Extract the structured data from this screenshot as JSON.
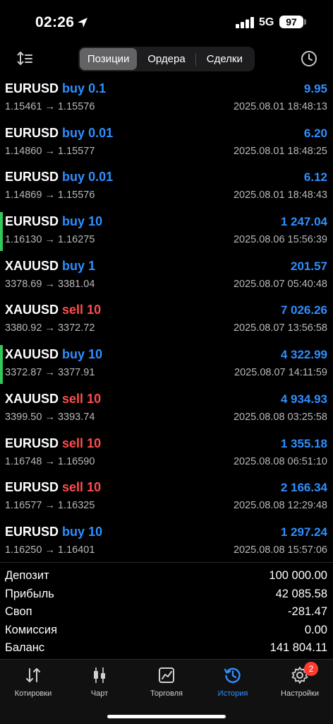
{
  "status": {
    "time": "02:26",
    "network": "5G",
    "battery": "97"
  },
  "tabs": [
    {
      "label": "Позиции",
      "active": true
    },
    {
      "label": "Ордера",
      "active": false
    },
    {
      "label": "Сделки",
      "active": false
    }
  ],
  "rows": [
    {
      "symbol": "EURUSD",
      "side": "buy",
      "volume": "0.1",
      "prices": "1.15461 → 1.15576",
      "profit": "9.95",
      "date": "2025.08.01 18:48:13",
      "marked": false
    },
    {
      "symbol": "EURUSD",
      "side": "buy",
      "volume": "0.01",
      "prices": "1.14860 → 1.15577",
      "profit": "6.20",
      "date": "2025.08.01 18:48:25",
      "marked": false
    },
    {
      "symbol": "EURUSD",
      "side": "buy",
      "volume": "0.01",
      "prices": "1.14869 → 1.15576",
      "profit": "6.12",
      "date": "2025.08.01 18:48:43",
      "marked": false
    },
    {
      "symbol": "EURUSD",
      "side": "buy",
      "volume": "10",
      "prices": "1.16130 → 1.16275",
      "profit": "1 247.04",
      "date": "2025.08.06 15:56:39",
      "marked": true
    },
    {
      "symbol": "XAUUSD",
      "side": "buy",
      "volume": "1",
      "prices": "3378.69 → 3381.04",
      "profit": "201.57",
      "date": "2025.08.07 05:40:48",
      "marked": false
    },
    {
      "symbol": "XAUUSD",
      "side": "sell",
      "volume": "10",
      "prices": "3380.92 → 3372.72",
      "profit": "7 026.26",
      "date": "2025.08.07 13:56:58",
      "marked": false
    },
    {
      "symbol": "XAUUSD",
      "side": "buy",
      "volume": "10",
      "prices": "3372.87 → 3377.91",
      "profit": "4 322.99",
      "date": "2025.08.07 14:11:59",
      "marked": true
    },
    {
      "symbol": "XAUUSD",
      "side": "sell",
      "volume": "10",
      "prices": "3399.50 → 3393.74",
      "profit": "4 934.93",
      "date": "2025.08.08 03:25:58",
      "marked": false
    },
    {
      "symbol": "EURUSD",
      "side": "sell",
      "volume": "10",
      "prices": "1.16748 → 1.16590",
      "profit": "1 355.18",
      "date": "2025.08.08 06:51:10",
      "marked": false
    },
    {
      "symbol": "EURUSD",
      "side": "sell",
      "volume": "10",
      "prices": "1.16577 → 1.16325",
      "profit": "2 166.34",
      "date": "2025.08.08 12:29:48",
      "marked": false
    },
    {
      "symbol": "EURUSD",
      "side": "buy",
      "volume": "10",
      "prices": "1.16250 → 1.16401",
      "profit": "1 297.24",
      "date": "2025.08.08 15:57:06",
      "marked": false
    }
  ],
  "summary": [
    {
      "label": "Депозит",
      "value": "100 000.00"
    },
    {
      "label": "Прибыль",
      "value": "42 085.58"
    },
    {
      "label": "Своп",
      "value": "-281.47"
    },
    {
      "label": "Комиссия",
      "value": "0.00"
    },
    {
      "label": "Баланс",
      "value": "141 804.11"
    }
  ],
  "tabbar": [
    {
      "label": "Котировки",
      "icon": "quotes-icon",
      "active": false
    },
    {
      "label": "Чарт",
      "icon": "chart-icon",
      "active": false
    },
    {
      "label": "Торговля",
      "icon": "trade-icon",
      "active": false
    },
    {
      "label": "История",
      "icon": "history-icon",
      "active": true
    },
    {
      "label": "Настройки",
      "icon": "settings-icon",
      "active": false,
      "badge": "2"
    }
  ],
  "colors": {
    "buy": "#2f8fff",
    "sell": "#ff4d4d",
    "marker": "#34c759",
    "active_tab": "#2f8fff",
    "badge": "#ff3b30"
  }
}
